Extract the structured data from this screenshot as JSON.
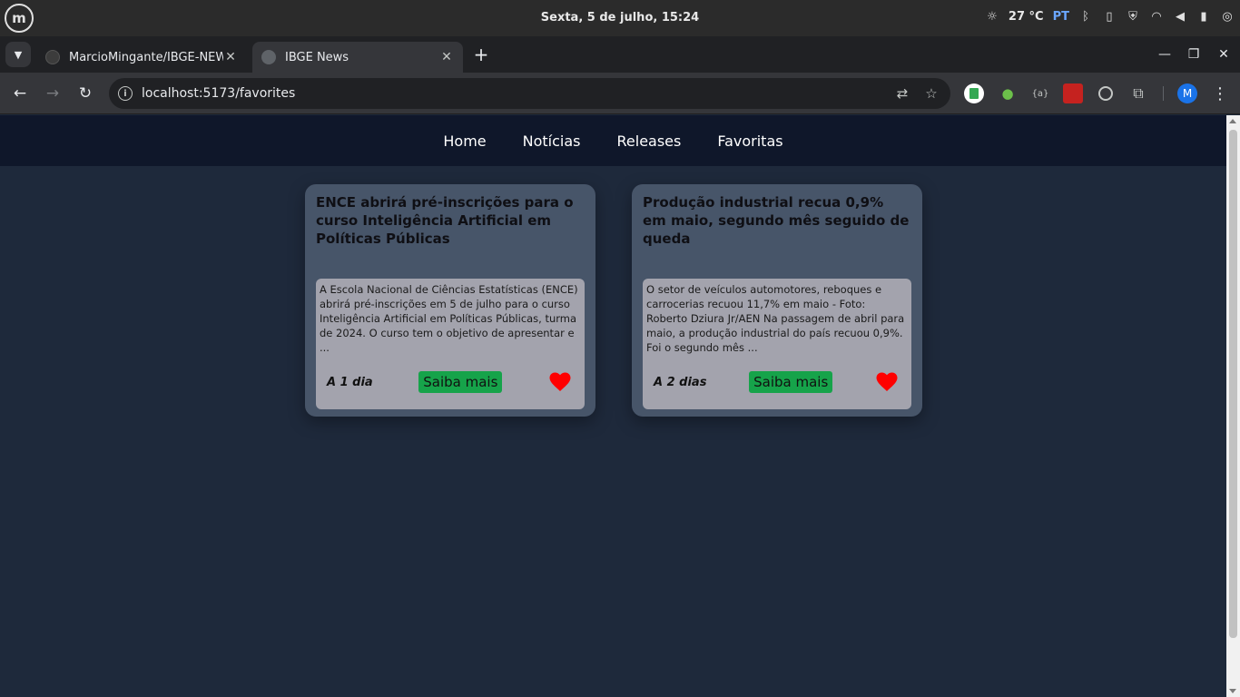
{
  "os": {
    "clock": "Sexta,  5 de julho, 15:24",
    "temperature": "27 °C",
    "language": "PT",
    "logo_icon": "linux-mint-icon"
  },
  "browser": {
    "tabs": [
      {
        "title": "MarcioMingante/IBGE-NEWS",
        "active": false
      },
      {
        "title": "IBGE News",
        "active": true
      }
    ],
    "url": "localhost:5173/favorites",
    "profile_initial": "M"
  },
  "site": {
    "nav": [
      "Home",
      "Notícias",
      "Releases",
      "Favoritas"
    ]
  },
  "cards": [
    {
      "title": "ENCE abrirá pré-inscrições para o curso Inteligência Artificial em Políticas Públicas",
      "summary": "A Escola Nacional de Ciências Estatísticas (ENCE) abrirá pré-inscrições em 5 de julho para o curso Inteligência Artificial em Políticas Públicas, turma de 2024. O curso tem o objetivo de apresentar e ...",
      "age": "A 1 dia",
      "button": "Saiba mais",
      "favorite": true
    },
    {
      "title": "Produção industrial recua 0,9% em maio, segundo mês seguido de queda",
      "summary": "O setor de veículos automotores, reboques e carrocerias recuou 11,7% em maio - Foto: Roberto Dziura Jr/AEN Na passagem de abril para maio, a produção industrial do país recuou 0,9%. Foi o segundo mês ...",
      "age": "A 2 dias",
      "button": "Saiba mais",
      "favorite": true
    }
  ],
  "colors": {
    "page_bg": "#1e293b",
    "nav_bg": "#0f172a",
    "card_bg": "#475569",
    "button_green": "#16a34a",
    "heart_red": "#ff0000"
  }
}
